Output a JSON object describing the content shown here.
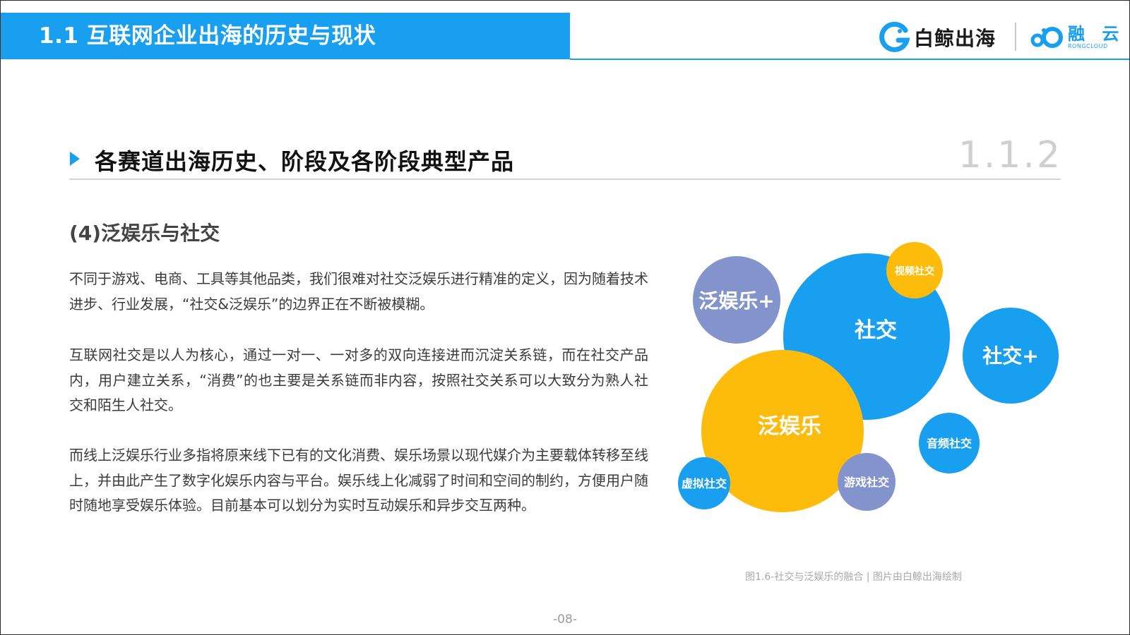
{
  "header": {
    "title": "1.1 互联网企业出海的历史与现状",
    "brand_primary": "白鲸出海",
    "brand_partner_cn": "融 云",
    "brand_partner_en": "RONGCLOUD",
    "accent_color": "#189ff0"
  },
  "section": {
    "title": "各赛道出海历史、阶段及各阶段典型产品",
    "number": "1.1.2"
  },
  "subtitle": "(4)泛娱乐与社交",
  "paragraphs": [
    "不同于游戏、电商、工具等其他品类，我们很难对社交泛娱乐进行精准的定义，因为随着技术进步、行业发展，“社交&泛娱乐”的边界正在不断被模糊。",
    "互联网社交是以人为核心，通过一对一、一对多的双向连接进而沉淀关系链，而在社交产品内，用户建立关系，“消费”的也主要是关系链而非内容，按照社交关系可以大致分为熟人社交和陌生人社交。",
    "而线上泛娱乐行业多指将原来线下已有的文化消费、娱乐场景以现代媒介为主要载体转移至线上，并由此产生了数字化娱乐内容与平台。娱乐线上化减弱了时间和空间的制约，方便用户随时随地享受娱乐体验。目前基本可以划分为实时互动娱乐和异步交互两种。"
  ],
  "diagram": {
    "bubbles": {
      "social": "社交",
      "entertainment": "泛娱乐",
      "entertainment_plus": "泛娱乐+",
      "social_plus": "社交+",
      "video_social": "视频社交",
      "audio_social": "音频社交",
      "game_social": "游戏社交",
      "virtual_social": "虚拟社交"
    },
    "colors": {
      "blue": "#189ff0",
      "yellow": "#fdbb0b",
      "purple": "#8394cc"
    }
  },
  "caption": "图1.6-社交与泛娱乐的融合 | 图片由白鲸出海绘制",
  "page_number": "-08-"
}
